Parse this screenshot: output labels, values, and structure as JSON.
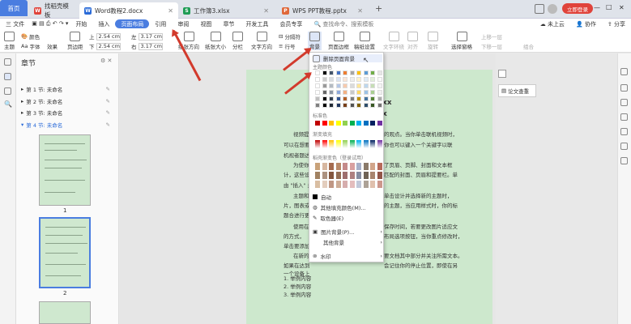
{
  "tabs": [
    {
      "label": "首页"
    },
    {
      "label": "找稻壳模板"
    },
    {
      "label": "Word教程2.docx"
    },
    {
      "label": "工作簿3.xlsx"
    },
    {
      "label": "WPS PPT教程.pptx"
    }
  ],
  "window": {
    "login": "立即登录",
    "min": "—",
    "max": "□",
    "close": "✕"
  },
  "menu": {
    "items": [
      "三 文件",
      "开始",
      "插入",
      "页面布局",
      "引用",
      "审阅",
      "视图",
      "章节",
      "开发工具",
      "会员专享"
    ],
    "search": "查找命令、搜索模板",
    "unsynced": "未上云",
    "collab": "协作",
    "share": "分享"
  },
  "ribbon": {
    "theme": "主题",
    "color": "颜色",
    "font": "字体",
    "effect": "效果",
    "margin": "页边距",
    "top_label": "上",
    "top_val": "2.54 cm",
    "bottom_label": "下",
    "bottom_val": "2.54 cm",
    "left_label": "左",
    "left_val": "3.17 cm",
    "right_label": "右",
    "right_val": "3.17 cm",
    "orientation": "纸张方向",
    "size": "纸张大小",
    "columns": "分栏",
    "textdir": "文字方向",
    "pagebreak": "分隔符",
    "lineno": "行号",
    "background": "背景",
    "border": "页面边框",
    "manuscript": "稿纸设置",
    "wrap": "文字环绕",
    "align": "对齐",
    "rotate": "旋转",
    "selpane": "选择窗格",
    "combine": "组合",
    "up": "上移一层",
    "down": "下移一层"
  },
  "nav": {
    "title": "章节",
    "items": [
      "第 1 节: 未命名",
      "第 2 节: 未命名",
      "第 3 节: 未命名",
      "第 4 节: 未命名"
    ],
    "page1": "1",
    "page2": "2"
  },
  "doc": {
    "h1": "xx",
    "h2": "x",
    "paras": [
      "视频提",
      "可以在想要",
      "机视者题达",
      "为使你",
      "计，这些设",
      "由 \"插入\" 并",
      "主题和",
      "片，图表或",
      "题合进行更",
      "使用在",
      "的方式，",
      "单击要添加",
      "在新的",
      "如果在达到",
      "一个设备上"
    ],
    "rparas": [
      "的观点。当你单击联机视频时，",
      "你也可以键入一个关键字以联",
      "了页眉、页脚、封面和文本框",
      "匹配的封面、页眉和提要栏。单",
      "单击设计并选择新的主题时，",
      "的主题，当应用样式时，你的标",
      "保存时间，若要更改图片适应文",
      "布局选项按钮，当你重点修改时，",
      "要文档其中部分并关注所需文本。",
      "会记住你的停止位置，即使在另"
    ],
    "list": [
      "1. 举例内容",
      "2. 举例内容",
      "3. 举例内容"
    ]
  },
  "dropdown": {
    "remove": "删除页面背景",
    "theme_colors": "主题颜色",
    "std_colors": "标准色",
    "gradient": "渐变填充",
    "gradient2": "稻壳渐变色（登录试用）",
    "auto": "自动",
    "more_fill": "其他填充颜色(M)...",
    "eyedrop": "取色器(E)",
    "picture": "图片背景(P)...",
    "other": "其他背景",
    "watermark": "水印"
  },
  "side": {
    "essay_check": "论文查重"
  },
  "colors": {
    "accent": "#4a7de0",
    "arrow": "#d23a2c",
    "page": "#cde8cd"
  },
  "theme_top": [
    "#ffffff",
    "#000000",
    "#44546a",
    "#4472c4",
    "#ed7d31",
    "#a5a5a5",
    "#ffc000",
    "#5b9bd5",
    "#70ad47",
    "#e7e6e6"
  ],
  "std": [
    "#c00000",
    "#ff0000",
    "#ffc000",
    "#ffff00",
    "#92d050",
    "#00b050",
    "#00b0f0",
    "#0070c0",
    "#002060",
    "#7030a0"
  ]
}
